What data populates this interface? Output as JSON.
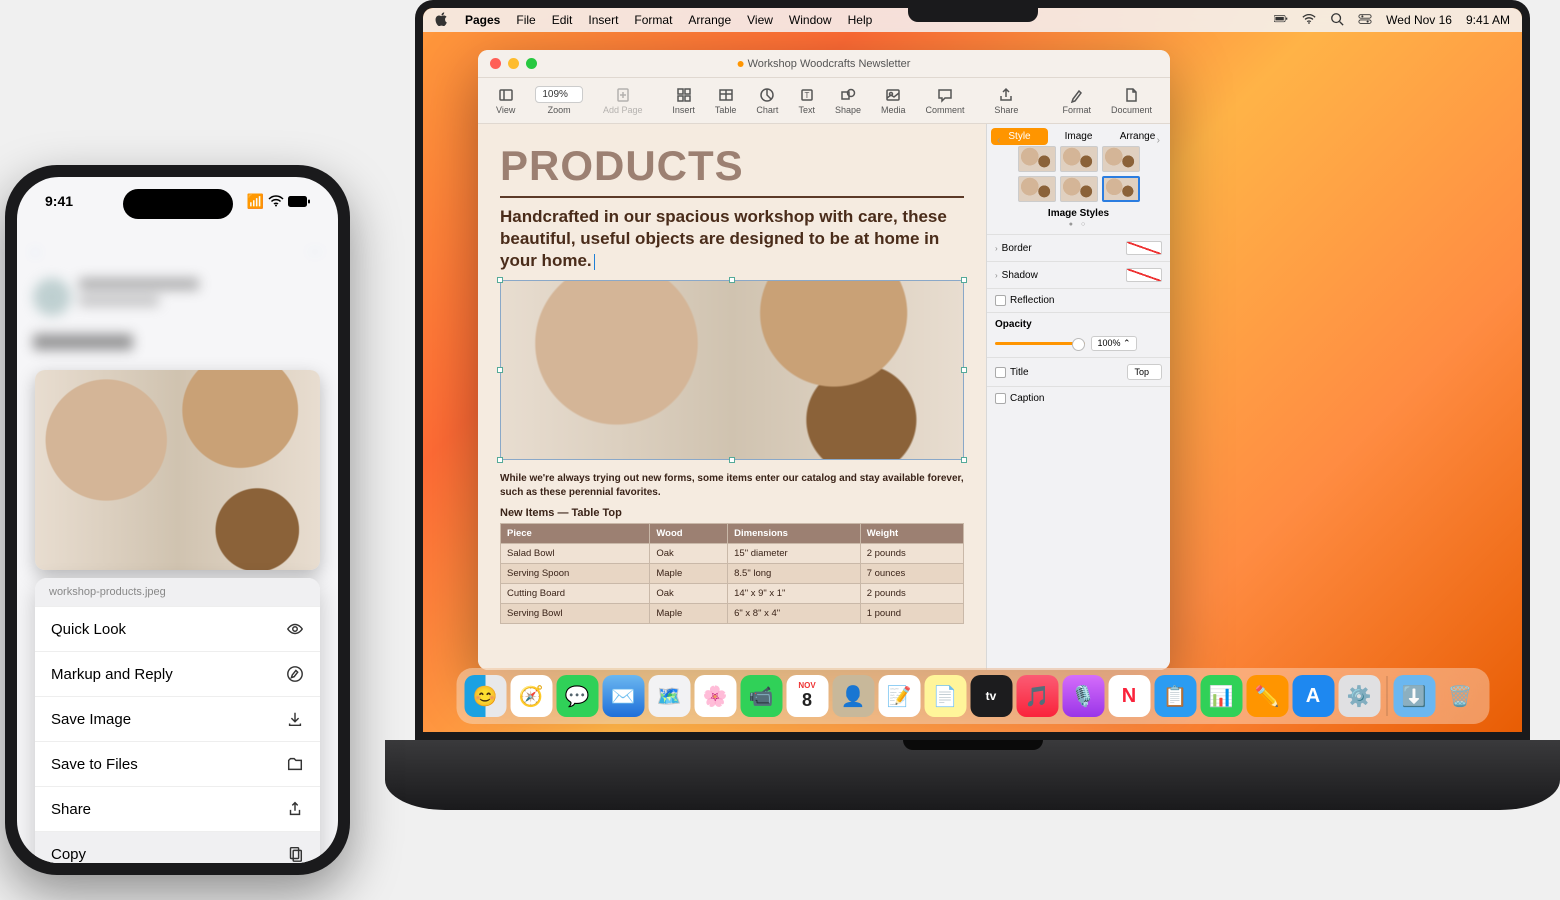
{
  "menubar": {
    "app": "Pages",
    "items": [
      "File",
      "Edit",
      "Insert",
      "Format",
      "Arrange",
      "View",
      "Window",
      "Help"
    ],
    "date": "Wed Nov 16",
    "time": "9:41 AM"
  },
  "pages": {
    "title": "Workshop Woodcrafts Newsletter",
    "toolbar": {
      "view": "View",
      "zoom": "Zoom",
      "zoom_pct": "109%",
      "add_page": "Add Page",
      "insert": "Insert",
      "table": "Table",
      "chart": "Chart",
      "text": "Text",
      "shape": "Shape",
      "media": "Media",
      "comment": "Comment",
      "share": "Share",
      "format": "Format",
      "document": "Document"
    },
    "doc": {
      "h1": "PRODUCTS",
      "sub": "Handcrafted in our spacious workshop with care, these beautiful, useful objects are designed to be at home in your home.",
      "para": "While we're always trying out new forms, some items enter our catalog and stay available forever, such as these perennial favorites.",
      "table_title": "New Items — Table Top",
      "headers": [
        "Piece",
        "Wood",
        "Dimensions",
        "Weight"
      ],
      "rows": [
        [
          "Salad Bowl",
          "Oak",
          "15\" diameter",
          "2 pounds"
        ],
        [
          "Serving Spoon",
          "Maple",
          "8.5\" long",
          "7 ounces"
        ],
        [
          "Cutting Board",
          "Oak",
          "14\" x 9\" x 1\"",
          "2 pounds"
        ],
        [
          "Serving Bowl",
          "Maple",
          "6\" x 8\" x 4\"",
          "1 pound"
        ]
      ]
    },
    "inspector": {
      "tabs": [
        "Style",
        "Image",
        "Arrange"
      ],
      "styles_label": "Image Styles",
      "border": "Border",
      "shadow": "Shadow",
      "reflection": "Reflection",
      "opacity": "Opacity",
      "opacity_val": "100%",
      "title": "Title",
      "title_pos": "Top",
      "caption": "Caption"
    }
  },
  "iphone": {
    "time": "9:41",
    "filename": "workshop-products.jpeg",
    "menu": [
      "Quick Look",
      "Markup and Reply",
      "Save Image",
      "Save to Files",
      "Share",
      "Copy"
    ]
  },
  "dock": {
    "cal_month": "NOV",
    "cal_day": "8"
  }
}
